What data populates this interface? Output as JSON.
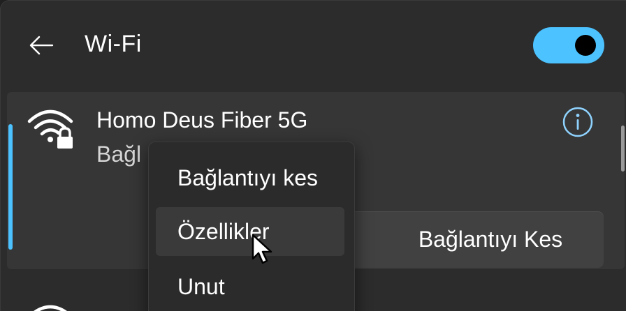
{
  "header": {
    "title": "Wi-Fi",
    "back_icon": "arrow-left-icon",
    "toggle": {
      "state": "on",
      "accent": "#4cc2ff"
    }
  },
  "network": {
    "name": "Homo Deus Fiber 5G",
    "status_visible": "Bağl",
    "icon": "wifi-secured-icon",
    "info_icon": "info-icon",
    "disconnect_label": "Bağlantıyı Kes"
  },
  "context_menu": {
    "items": [
      {
        "label": "Bağlantıyı kes"
      },
      {
        "label": "Özellikler",
        "highlighted": true
      },
      {
        "label": "Unut"
      }
    ]
  },
  "colors": {
    "accent": "#4cc2ff",
    "panel": "#2c2c2c",
    "card": "#363636",
    "menu": "#2b2b2b"
  }
}
